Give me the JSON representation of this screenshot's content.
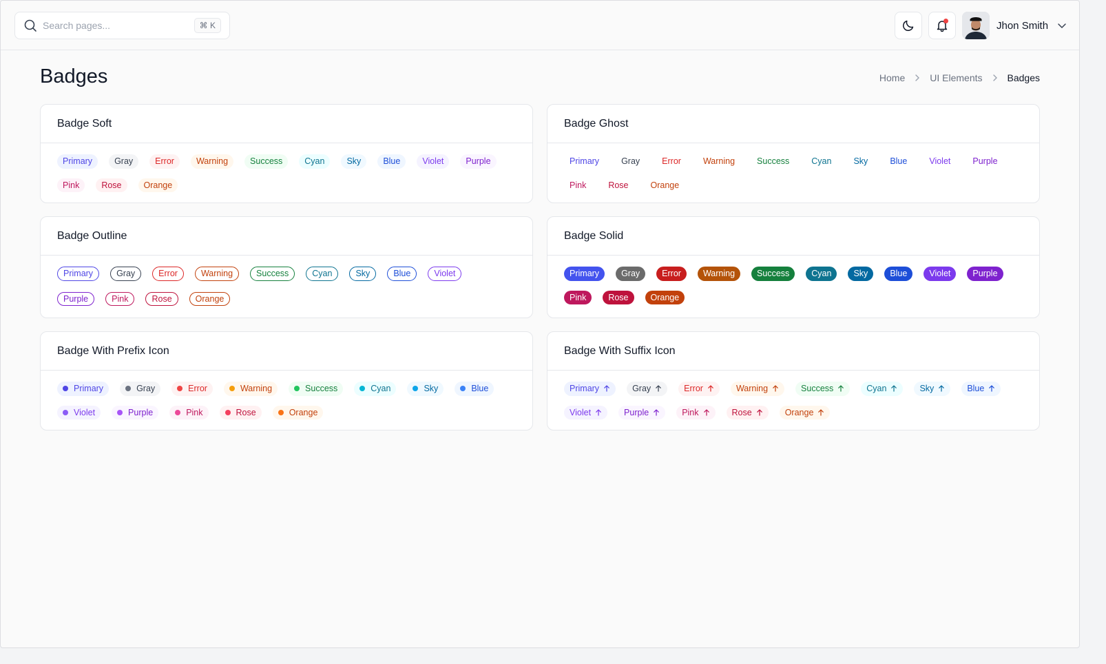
{
  "header": {
    "search_placeholder": "Search pages...",
    "search_shortcut": "⌘ K",
    "user_name": "Jhon Smith"
  },
  "page": {
    "title": "Badges",
    "breadcrumb": [
      "Home",
      "UI Elements",
      "Badges"
    ]
  },
  "cards": {
    "soft": "Badge Soft",
    "ghost": "Badge Ghost",
    "outline": "Badge Outline",
    "solid": "Badge Solid",
    "prefix": "Badge With Prefix Icon",
    "suffix": "Badge With Suffix Icon"
  },
  "badges": [
    {
      "label": "Primary",
      "text": "#4f46e5",
      "bg": "#eef2ff",
      "solid": "#4353ee",
      "dot": "#4f46e5"
    },
    {
      "label": "Gray",
      "text": "#374151",
      "bg": "#f3f4f6",
      "solid": "#6b6b6b",
      "dot": "#6b7280"
    },
    {
      "label": "Error",
      "text": "#dc2626",
      "bg": "#fef2f2",
      "solid": "#c81e1e",
      "dot": "#ef4444"
    },
    {
      "label": "Warning",
      "text": "#c2410c",
      "bg": "#fff7ed",
      "solid": "#b45309",
      "dot": "#f59e0b"
    },
    {
      "label": "Success",
      "text": "#15803d",
      "bg": "#f0fdf4",
      "solid": "#15803d",
      "dot": "#22c55e"
    },
    {
      "label": "Cyan",
      "text": "#0e7490",
      "bg": "#ecfeff",
      "solid": "#0e7490",
      "dot": "#06b6d4"
    },
    {
      "label": "Sky",
      "text": "#0369a1",
      "bg": "#f0f9ff",
      "solid": "#0369a1",
      "dot": "#0ea5e9"
    },
    {
      "label": "Blue",
      "text": "#1d4ed8",
      "bg": "#eff6ff",
      "solid": "#1d4ed8",
      "dot": "#3b82f6"
    },
    {
      "label": "Violet",
      "text": "#7c3aed",
      "bg": "#f5f3ff",
      "solid": "#7c3aed",
      "dot": "#8b5cf6"
    },
    {
      "label": "Purple",
      "text": "#7e22ce",
      "bg": "#faf5ff",
      "solid": "#7e22ce",
      "dot": "#a855f7"
    },
    {
      "label": "Pink",
      "text": "#be185d",
      "bg": "#fdf2f8",
      "solid": "#be185d",
      "dot": "#ec4899"
    },
    {
      "label": "Rose",
      "text": "#be123c",
      "bg": "#fff1f2",
      "solid": "#be123c",
      "dot": "#f43f5e"
    },
    {
      "label": "Orange",
      "text": "#c2410c",
      "bg": "#fff7ed",
      "solid": "#c2410c",
      "dot": "#f97316"
    }
  ]
}
